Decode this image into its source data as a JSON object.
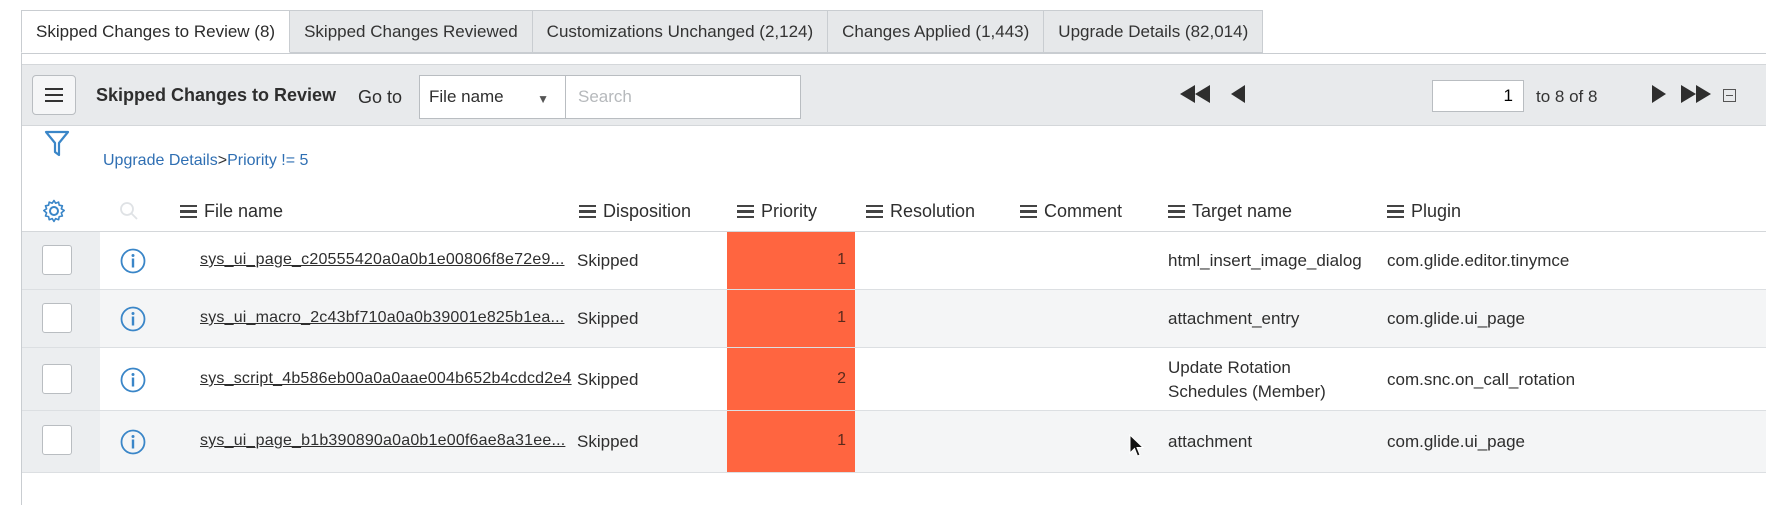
{
  "tabs": [
    {
      "label": "Skipped Changes to Review (8)",
      "active": true
    },
    {
      "label": "Skipped Changes Reviewed",
      "active": false
    },
    {
      "label": "Customizations Unchanged (2,124)",
      "active": false
    },
    {
      "label": "Changes Applied (1,443)",
      "active": false
    },
    {
      "label": "Upgrade Details (82,014)",
      "active": false
    }
  ],
  "toolbar": {
    "title": "Skipped Changes to Review",
    "goto_label": "Go to",
    "field_selected": "File name",
    "search_placeholder": "Search",
    "page_value": "1",
    "page_range": "to 8 of 8"
  },
  "breadcrumb": {
    "items": [
      "Upgrade Details",
      "Priority != 5"
    ],
    "separator": ">"
  },
  "columns": {
    "file_name": "File name",
    "disposition": "Disposition",
    "priority": "Priority",
    "resolution": "Resolution",
    "comment": "Comment",
    "target_name": "Target name",
    "plugin": "Plugin"
  },
  "rows": [
    {
      "file_name": "sys_ui_page_c20555420a0a0b1e00806f8e72e9...",
      "disposition": "Skipped",
      "priority": "1",
      "resolution": "",
      "comment": "",
      "target_line1": "html_insert_image_dialog",
      "target_line2": "",
      "plugin": "com.glide.editor.tinymce"
    },
    {
      "file_name": "sys_ui_macro_2c43bf710a0a0b39001e825b1ea...",
      "disposition": "Skipped",
      "priority": "1",
      "resolution": "",
      "comment": "",
      "target_line1": "attachment_entry",
      "target_line2": "",
      "plugin": "com.glide.ui_page"
    },
    {
      "file_name": "sys_script_4b586eb00a0a0aae004b652b4cdcd2e4",
      "disposition": "Skipped",
      "priority": "2",
      "resolution": "",
      "comment": "",
      "target_line1": "Update Rotation",
      "target_line2": "Schedules (Member)",
      "plugin": "com.snc.on_call_rotation"
    },
    {
      "file_name": "sys_ui_page_b1b390890a0a0b1e00f6ae8a31ee...",
      "disposition": "Skipped",
      "priority": "1",
      "resolution": "",
      "comment": "",
      "target_line1": "attachment",
      "target_line2": "",
      "plugin": "com.glide.ui_page"
    }
  ],
  "colors": {
    "priority_high": "#ff6540",
    "link": "#2f6fb3",
    "icon_blue": "#3a86c8"
  },
  "icons": [
    "menu-icon",
    "caret-down-icon",
    "first-page-icon",
    "prev-page-icon",
    "next-page-icon",
    "last-page-icon",
    "collapse-icon",
    "filter-icon",
    "gear-icon",
    "search-icon",
    "info-icon",
    "cursor-icon"
  ]
}
